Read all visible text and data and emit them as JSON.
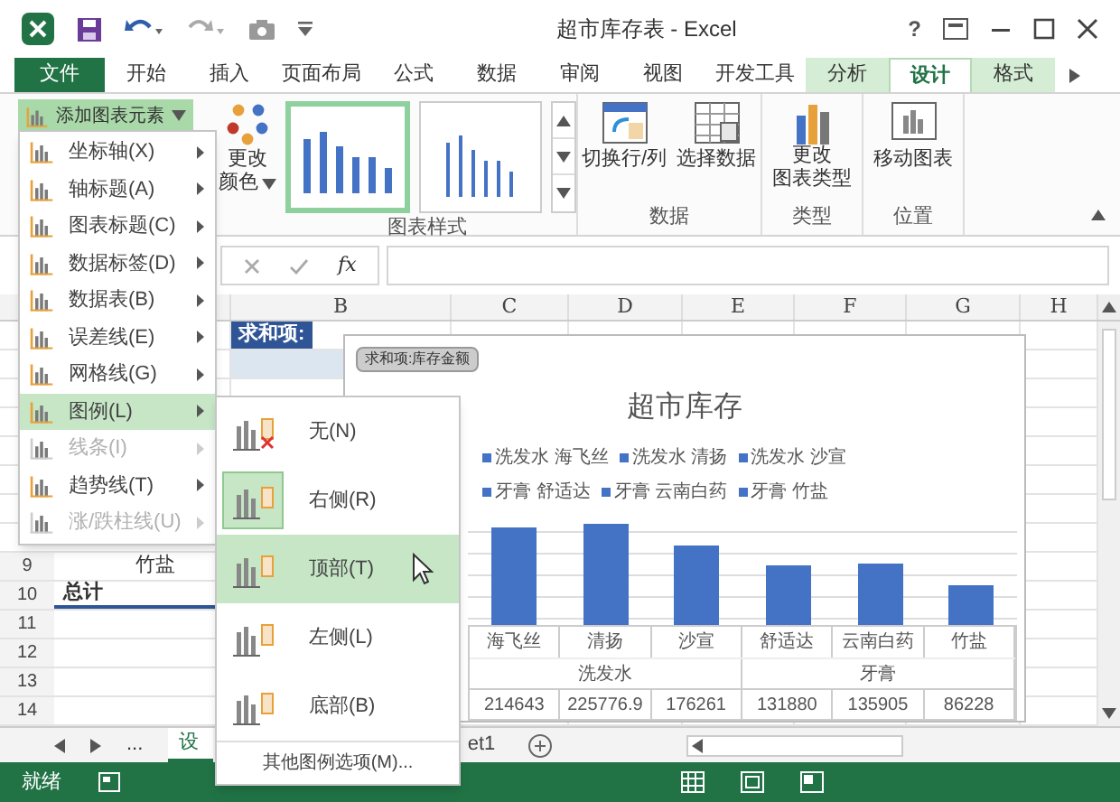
{
  "window": {
    "title": "超市库存表 - Excel",
    "help": "?"
  },
  "tabs": [
    {
      "label": "文件",
      "kind": "file",
      "selected": false
    },
    {
      "label": "开始",
      "kind": "normal",
      "selected": false
    },
    {
      "label": "插入",
      "kind": "normal",
      "selected": false
    },
    {
      "label": "页面布局",
      "kind": "normal",
      "selected": false
    },
    {
      "label": "公式",
      "kind": "normal",
      "selected": false
    },
    {
      "label": "数据",
      "kind": "normal",
      "selected": false
    },
    {
      "label": "审阅",
      "kind": "normal",
      "selected": false
    },
    {
      "label": "视图",
      "kind": "normal",
      "selected": false
    },
    {
      "label": "开发工具",
      "kind": "normal",
      "selected": false
    },
    {
      "label": "分析",
      "kind": "context",
      "selected": false
    },
    {
      "label": "设计",
      "kind": "context",
      "selected": true
    },
    {
      "label": "格式",
      "kind": "context",
      "selected": false
    }
  ],
  "ribbon": {
    "add_element": {
      "label": "添加图表元素",
      "pressed": true
    },
    "change_colors": {
      "line1": "更改",
      "line2": "颜色"
    },
    "styles": [
      {
        "selected": true
      },
      {
        "selected": false
      }
    ],
    "groups": [
      {
        "label": "图表样式"
      },
      {
        "label": "数据"
      },
      {
        "label": "类型"
      },
      {
        "label": "位置"
      }
    ],
    "switch_row_col": "切换行/列",
    "select_data": "选择数据",
    "change_type": {
      "line1": "更改",
      "line2": "图表类型"
    },
    "move_chart": "移动图表"
  },
  "formula_bar": {
    "fx": "fx"
  },
  "columns": [
    "B",
    "C",
    "D",
    "E",
    "F",
    "G",
    "H"
  ],
  "rows": [
    {
      "kind": "pivot-header",
      "text": "求和项:"
    },
    {
      "kind": "band"
    },
    {
      "kind": "blank"
    },
    {
      "kind": "blank"
    },
    {
      "kind": "blank"
    },
    {
      "kind": "blank"
    },
    {
      "kind": "blank"
    },
    {
      "kind": "blank"
    },
    {
      "kind": "item",
      "number": "9",
      "text": "竹盐"
    },
    {
      "kind": "total",
      "number": "10",
      "text": "总计"
    },
    {
      "kind": "blank",
      "number": "11"
    },
    {
      "kind": "blank",
      "number": "12"
    },
    {
      "kind": "blank",
      "number": "13"
    },
    {
      "kind": "blank",
      "number": "14"
    }
  ],
  "chart": {
    "field_button": "求和项:库存金额",
    "legend": [
      "洗发水 海飞丝",
      "洗发水 清扬",
      "洗发水 沙宣",
      "牙膏 舒适达",
      "牙膏 云南白药",
      "牙膏 竹盐"
    ],
    "chart_data": {
      "type": "bar",
      "title": "超市库存",
      "categories": [
        "海飞丝",
        "清扬",
        "沙宣",
        "舒适达",
        "云南白药",
        "竹盐"
      ],
      "values": [
        214643,
        225776.9,
        176261,
        131880,
        135905,
        86228
      ],
      "value_labels": [
        "214643",
        "225776.9",
        "176261",
        "131880",
        "135905",
        "86228"
      ]
    },
    "data_table": {
      "groups": [
        "洗发水",
        "牙膏"
      ]
    }
  },
  "menu": [
    {
      "label": "坐标轴(X)",
      "selected": false,
      "disabled": false
    },
    {
      "label": "轴标题(A)",
      "selected": false,
      "disabled": false
    },
    {
      "label": "图表标题(C)",
      "selected": false,
      "disabled": false
    },
    {
      "label": "数据标签(D)",
      "selected": false,
      "disabled": false
    },
    {
      "label": "数据表(B)",
      "selected": false,
      "disabled": false
    },
    {
      "label": "误差线(E)",
      "selected": false,
      "disabled": false
    },
    {
      "label": "网格线(G)",
      "selected": false,
      "disabled": false
    },
    {
      "label": "图例(L)",
      "selected": true,
      "disabled": false
    },
    {
      "label": "线条(I)",
      "selected": false,
      "disabled": true
    },
    {
      "label": "趋势线(T)",
      "selected": false,
      "disabled": false
    },
    {
      "label": "涨/跌柱线(U)",
      "selected": false,
      "disabled": true
    }
  ],
  "submenu": {
    "items": [
      {
        "label": "无(N)",
        "selected": false,
        "hovered": false
      },
      {
        "label": "右侧(R)",
        "selected": true,
        "hovered": false
      },
      {
        "label": "顶部(T)",
        "selected": false,
        "hovered": true
      },
      {
        "label": "左侧(L)",
        "selected": false,
        "hovered": false
      },
      {
        "label": "底部(B)",
        "selected": false,
        "hovered": false
      }
    ],
    "more": "其他图例选项(M)..."
  },
  "sheet_tabs": {
    "more": "...",
    "tabs": [
      {
        "label": "设",
        "selected": true
      },
      {
        "label": "et1",
        "selected": false
      }
    ]
  },
  "status_bar": {
    "text": "就绪"
  }
}
